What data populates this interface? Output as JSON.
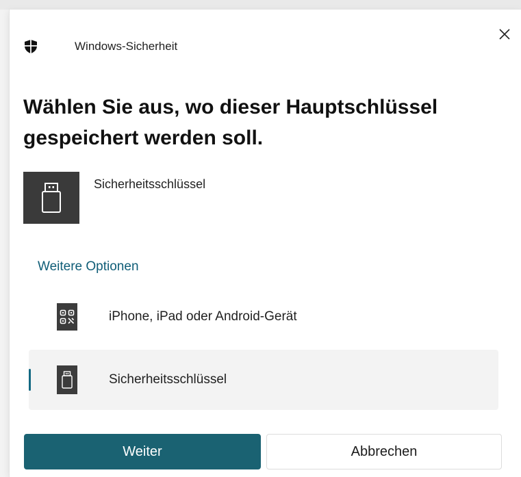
{
  "app": {
    "title": "Windows-Sicherheit",
    "close_glyph": "×"
  },
  "dialog": {
    "heading": "Wählen Sie aus, wo dieser Hauptschlüssel gespeichert werden soll.",
    "selected_device": {
      "label": "Sicherheitsschlüssel",
      "icon": "usb-key-icon"
    },
    "more_options_label": "Weitere Optionen",
    "options": [
      {
        "label": "iPhone, iPad oder Android-Gerät",
        "icon": "qr-code-icon",
        "selected": false
      },
      {
        "label": "Sicherheitsschlüssel",
        "icon": "usb-key-icon",
        "selected": true
      }
    ]
  },
  "buttons": {
    "primary_label": "Weiter",
    "secondary_label": "Abbrechen"
  },
  "colors": {
    "accent": "#1a6272",
    "link": "#0f5d77",
    "tile": "#3a3a3a",
    "selected_bg": "#f3f3f3"
  }
}
